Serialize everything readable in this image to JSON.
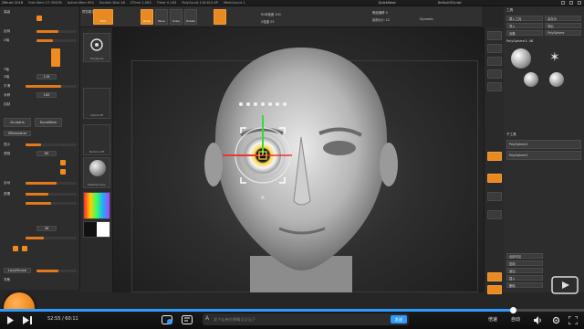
{
  "titlebar": {
    "app": "ZBrush 2018",
    "stats": [
      "Free Mem 27.354GB",
      "Active Mem 954",
      "Scratch Disk 48",
      "ZTime 1.083",
      "Timer 0.163",
      "PolyCount 118.614 KP",
      "MeshCount 1"
    ],
    "quicksave": "QuickSave",
    "default": "DefaultZScript"
  },
  "left_panel": {
    "top_label": "高级",
    "rows": [
      "反转",
      "X轴",
      "Y轴",
      "Z轴",
      "平滑",
      "对称",
      "控制",
      "显示",
      "透视",
      "自动",
      "遮罩"
    ],
    "buttons": [
      "Sculptris",
      "DynaMesh",
      "ZRemesher"
    ],
    "values": [
      "118",
      "100",
      "60",
      "36"
    ],
    "labels": [
      "LazyMouse",
      "灵敏"
    ],
    "slider_values": [
      0.55,
      0.4,
      0.7,
      0.3,
      0.6,
      0.45,
      0.5,
      0.35
    ]
  },
  "tool_column": {
    "cards": [
      "Transpose",
      "Alpha Off",
      "Texture Off",
      "MatCap Gray"
    ]
  },
  "toolbar": {
    "buttons": [
      "Edit",
      "Draw",
      "Move",
      "Scale",
      "Rotate"
    ],
    "label_left": "预览模式",
    "focal_label": "焦距偏移 0",
    "draw_size_label": "绘制大小 12",
    "dynamic_label": "Dynamic",
    "rgb_intensity": "RGB强度 100",
    "z_intensity": "Z强度 25"
  },
  "right_panel": {
    "sections": [
      "工具",
      "载入工具",
      "另存为",
      "导入",
      "导出",
      "克隆",
      "PolySphere",
      "子工具"
    ],
    "current_tool": "PolySphere1: 48",
    "subtools": [
      "PolySphere1",
      "PolySphere1"
    ],
    "bottom_buttons": [
      "全部可见",
      "复制",
      "追加",
      "插入",
      "删除"
    ]
  },
  "player": {
    "time_current": "52:55",
    "time_total": "60:11",
    "danmu_placeholder": "发个友善的弹幕见证当下",
    "send": "发送",
    "speed": "倍速",
    "quality": "自动",
    "progress": 0.879
  },
  "colors": {
    "accent": "#f08c1e",
    "progress": "#2f9bff",
    "panel": "#2d2d2d"
  }
}
